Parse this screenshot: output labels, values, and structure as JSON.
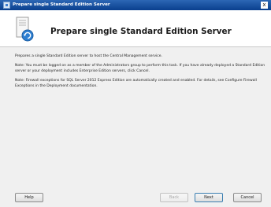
{
  "window": {
    "title": "Prepare single Standard Edition Server",
    "close_glyph": "x"
  },
  "header": {
    "title": "Prepare single Standard Edition Server",
    "icon": "server-with-refresh-icon"
  },
  "content": {
    "paragraphs": [
      "Prepares a single Standard Edition server to host the Central Management service.",
      "Note: You must be logged on as a member of the Administrators group to perform this task. If you have already deployed a Standard Edition server or your deployment includes Enterprise Edition servers, click Cancel.",
      "Note: Firewall exceptions for SQL Server 2012 Express Edition are automatically created and enabled. For details, see Configure Firewall Exceptions in the Deployment documentation."
    ]
  },
  "buttons": {
    "help": "Help",
    "back": "Back",
    "next": "Next",
    "cancel": "Cancel"
  },
  "colors": {
    "titlebar": "#0a3f8e",
    "dialog_bg": "#f0f0f0",
    "header_bg": "#ffffff"
  }
}
